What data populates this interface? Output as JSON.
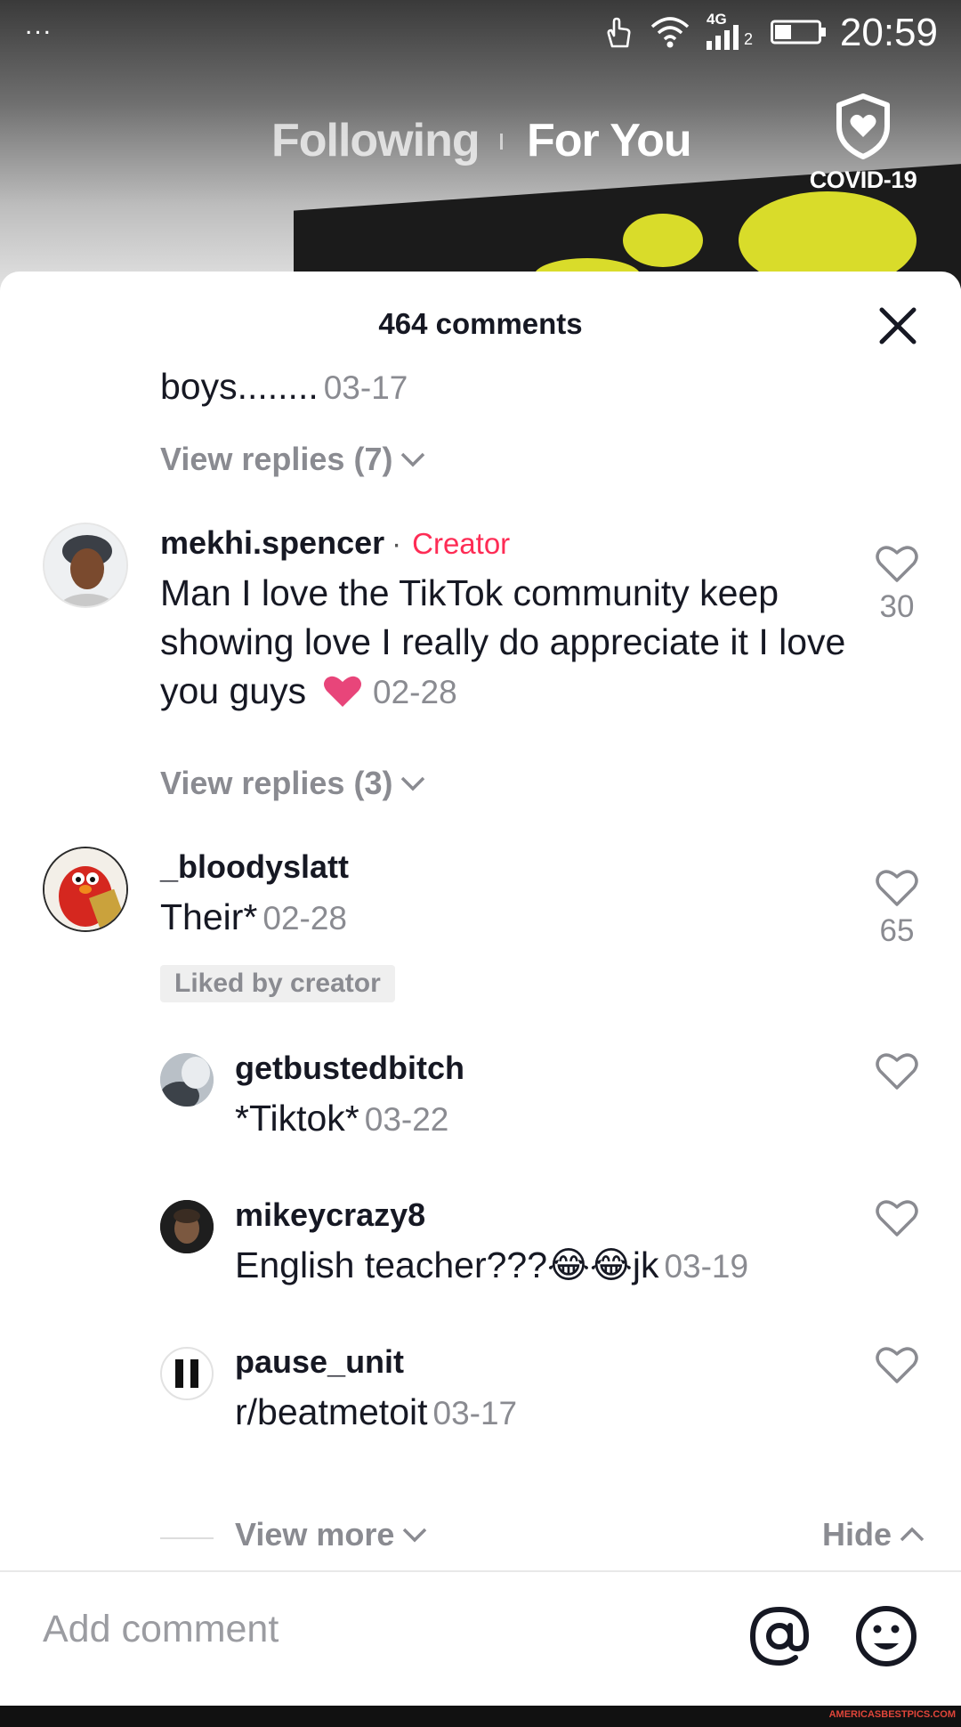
{
  "status_bar": {
    "time": "20:59",
    "network_label": "4G",
    "sim_label": "2",
    "overflow": "..."
  },
  "nav": {
    "following": "Following",
    "for_you": "For You",
    "covid_label": "COVID-19"
  },
  "comments_panel": {
    "count_label": "464 comments",
    "partial_comment": {
      "text": "boys........",
      "date": "03-17",
      "view_replies": "View replies (7)"
    },
    "comments": [
      {
        "username": "mekhi.spencer",
        "separator": "·",
        "badge": "Creator",
        "text": "Man I love the TikTok community keep showing love I really do appreciate it I love you guys",
        "emoji": "❤",
        "date": "02-28",
        "likes": "30",
        "view_replies": "View replies (3)"
      },
      {
        "username": "_bloodyslatt",
        "text": "Their*",
        "date": "02-28",
        "likes": "65",
        "liked_by_creator": "Liked by creator",
        "replies": [
          {
            "username": "getbustedbitch",
            "text": "*Tiktok*",
            "date": "03-22"
          },
          {
            "username": "mikeycrazy8",
            "text": "English teacher???😂😂jk",
            "date": "03-19"
          },
          {
            "username": "pause_unit",
            "text": "r/beatmetoit",
            "date": "03-17"
          }
        ]
      }
    ],
    "view_more": "View more",
    "hide": "Hide"
  },
  "input": {
    "placeholder": "Add comment"
  },
  "watermark": "AMERICASBESTPICS.COM",
  "colors": {
    "creator_accent": "#fe2c55",
    "heart_pink": "#e8457a",
    "muted_text": "#8a8b91"
  }
}
